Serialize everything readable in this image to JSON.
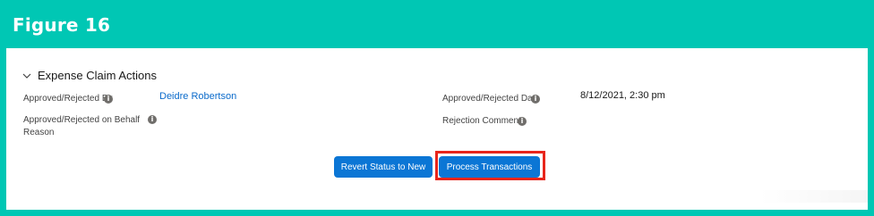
{
  "figure": {
    "title": "Figure 16"
  },
  "section": {
    "title": "Expense Claim Actions"
  },
  "fields": {
    "approved_by_label": "Approved/Rejected By",
    "approved_by_value": "Deidre Robertson",
    "approved_date_label": "Approved/Rejected Date",
    "approved_date_value": "8/12/2021, 2:30 pm",
    "behalf_reason_label_line1": "Approved/Rejected on Behalf",
    "behalf_reason_label_line2": "Reason",
    "rejection_comments_label": "Rejection Comments"
  },
  "buttons": {
    "revert": "Revert Status to New",
    "process": "Process Transactions"
  },
  "colors": {
    "frame": "#00c7b4",
    "button": "#0b76d5",
    "link": "#0b6bcb",
    "highlight": "#e8251b"
  },
  "icons": {
    "info": "i",
    "chevron": "chevron-down-icon"
  }
}
